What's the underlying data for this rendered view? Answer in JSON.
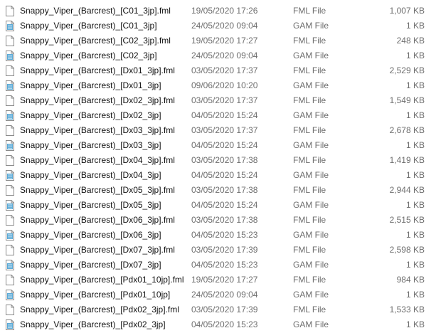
{
  "colors": {
    "name_text": "#111111",
    "meta_text": "#6d6d6d",
    "plain_icon_border": "#8a8a8a",
    "gam_icon_fill": "#5aa9d6"
  },
  "files": [
    {
      "name": "Snappy_Viper_(Barcrest)_[C01_3jp].fml",
      "date": "19/05/2020 17:26",
      "type": "FML File",
      "size": "1,007 KB",
      "icon": "plain-file-icon"
    },
    {
      "name": "Snappy_Viper_(Barcrest)_[C01_3jp]",
      "date": "24/05/2020 09:04",
      "type": "GAM File",
      "size": "1 KB",
      "icon": "gam-file-icon"
    },
    {
      "name": "Snappy_Viper_(Barcrest)_[C02_3jp].fml",
      "date": "19/05/2020 17:27",
      "type": "FML File",
      "size": "248 KB",
      "icon": "plain-file-icon"
    },
    {
      "name": "Snappy_Viper_(Barcrest)_[C02_3jp]",
      "date": "24/05/2020 09:04",
      "type": "GAM File",
      "size": "1 KB",
      "icon": "gam-file-icon"
    },
    {
      "name": "Snappy_Viper_(Barcrest)_[Dx01_3jp].fml",
      "date": "03/05/2020 17:37",
      "type": "FML File",
      "size": "2,529 KB",
      "icon": "plain-file-icon"
    },
    {
      "name": "Snappy_Viper_(Barcrest)_[Dx01_3jp]",
      "date": "09/06/2020 10:20",
      "type": "GAM File",
      "size": "1 KB",
      "icon": "gam-file-icon"
    },
    {
      "name": "Snappy_Viper_(Barcrest)_[Dx02_3jp].fml",
      "date": "03/05/2020 17:37",
      "type": "FML File",
      "size": "1,549 KB",
      "icon": "plain-file-icon"
    },
    {
      "name": "Snappy_Viper_(Barcrest)_[Dx02_3jp]",
      "date": "04/05/2020 15:24",
      "type": "GAM File",
      "size": "1 KB",
      "icon": "gam-file-icon"
    },
    {
      "name": "Snappy_Viper_(Barcrest)_[Dx03_3jp].fml",
      "date": "03/05/2020 17:37",
      "type": "FML File",
      "size": "2,678 KB",
      "icon": "plain-file-icon"
    },
    {
      "name": "Snappy_Viper_(Barcrest)_[Dx03_3jp]",
      "date": "04/05/2020 15:24",
      "type": "GAM File",
      "size": "1 KB",
      "icon": "gam-file-icon"
    },
    {
      "name": "Snappy_Viper_(Barcrest)_[Dx04_3jp].fml",
      "date": "03/05/2020 17:38",
      "type": "FML File",
      "size": "1,419 KB",
      "icon": "plain-file-icon"
    },
    {
      "name": "Snappy_Viper_(Barcrest)_[Dx04_3jp]",
      "date": "04/05/2020 15:24",
      "type": "GAM File",
      "size": "1 KB",
      "icon": "gam-file-icon"
    },
    {
      "name": "Snappy_Viper_(Barcrest)_[Dx05_3jp].fml",
      "date": "03/05/2020 17:38",
      "type": "FML File",
      "size": "2,944 KB",
      "icon": "plain-file-icon"
    },
    {
      "name": "Snappy_Viper_(Barcrest)_[Dx05_3jp]",
      "date": "04/05/2020 15:24",
      "type": "GAM File",
      "size": "1 KB",
      "icon": "gam-file-icon"
    },
    {
      "name": "Snappy_Viper_(Barcrest)_[Dx06_3jp].fml",
      "date": "03/05/2020 17:38",
      "type": "FML File",
      "size": "2,515 KB",
      "icon": "plain-file-icon"
    },
    {
      "name": "Snappy_Viper_(Barcrest)_[Dx06_3jp]",
      "date": "04/05/2020 15:23",
      "type": "GAM File",
      "size": "1 KB",
      "icon": "gam-file-icon"
    },
    {
      "name": "Snappy_Viper_(Barcrest)_[Dx07_3jp].fml",
      "date": "03/05/2020 17:39",
      "type": "FML File",
      "size": "2,598 KB",
      "icon": "plain-file-icon"
    },
    {
      "name": "Snappy_Viper_(Barcrest)_[Dx07_3jp]",
      "date": "04/05/2020 15:23",
      "type": "GAM File",
      "size": "1 KB",
      "icon": "gam-file-icon"
    },
    {
      "name": "Snappy_Viper_(Barcrest)_[Pdx01_10jp].fml",
      "date": "19/05/2020 17:27",
      "type": "FML File",
      "size": "984 KB",
      "icon": "plain-file-icon"
    },
    {
      "name": "Snappy_Viper_(Barcrest)_[Pdx01_10jp]",
      "date": "24/05/2020 09:04",
      "type": "GAM File",
      "size": "1 KB",
      "icon": "gam-file-icon"
    },
    {
      "name": "Snappy_Viper_(Barcrest)_[Pdx02_3jp].fml",
      "date": "03/05/2020 17:39",
      "type": "FML File",
      "size": "1,533 KB",
      "icon": "plain-file-icon"
    },
    {
      "name": "Snappy_Viper_(Barcrest)_[Pdx02_3jp]",
      "date": "04/05/2020 15:23",
      "type": "GAM File",
      "size": "1 KB",
      "icon": "gam-file-icon"
    }
  ]
}
